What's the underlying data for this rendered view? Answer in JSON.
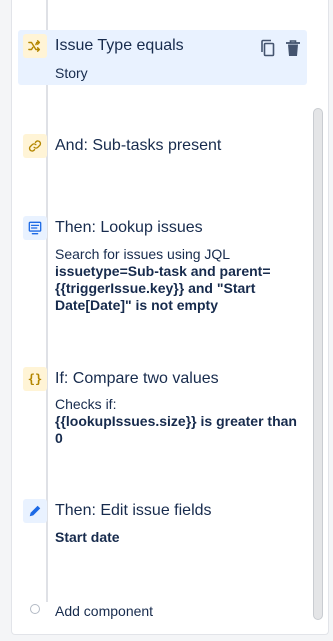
{
  "components": [
    {
      "type": "condition",
      "icon": "shuffle-icon",
      "title": "Issue Type equals",
      "description": "Story",
      "selected": true,
      "actions": [
        "copy-icon",
        "trash-icon"
      ]
    },
    {
      "type": "branch",
      "icon": "link-icon",
      "title": "And: Sub-tasks present"
    },
    {
      "type": "action",
      "icon": "lookup-icon",
      "title": "Then: Lookup issues",
      "description_plain": "Search for issues using JQL",
      "description_bold": "issuetype=Sub-task and parent={{triggerIssue.key}} and \"Start Date[Date]\" is not empty"
    },
    {
      "type": "condition",
      "icon": "braces-icon",
      "title": "If: Compare two values",
      "description_plain": "Checks if:",
      "description_bold": "{{lookupIssues.size}} is greater than 0"
    },
    {
      "type": "action",
      "icon": "pencil-icon",
      "title": "Then: Edit issue fields",
      "description_bold": "Start date"
    }
  ],
  "add_component_label": "Add component",
  "colors": {
    "condition_icon_bg": "#fff4d6",
    "condition_icon": "#b38600",
    "action_icon_bg": "#e9f2ff",
    "action_icon": "#1d6ae5",
    "selected_bg": "#e9f2ff"
  }
}
